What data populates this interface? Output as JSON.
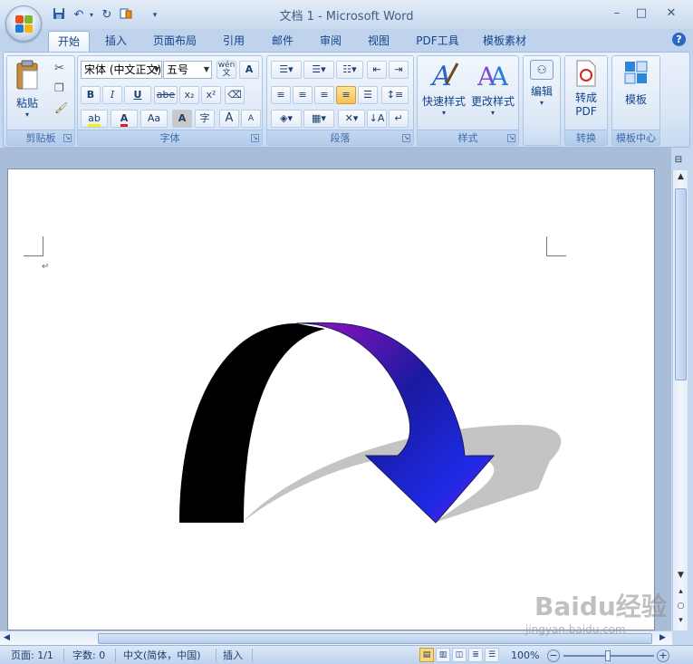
{
  "window": {
    "title": "文档 1 - Microsoft Word",
    "minimize": "–",
    "maximize": "□",
    "close": "✕"
  },
  "quick_access": [
    "save-icon",
    "undo-icon",
    "redo-icon",
    "print-layout-icon",
    "customize-arrow-icon"
  ],
  "tabs": [
    {
      "label": "开始",
      "active": true
    },
    {
      "label": "插入"
    },
    {
      "label": "页面布局"
    },
    {
      "label": "引用"
    },
    {
      "label": "邮件"
    },
    {
      "label": "审阅"
    },
    {
      "label": "视图"
    },
    {
      "label": "PDF工具"
    },
    {
      "label": "模板素材"
    }
  ],
  "ribbon": {
    "clipboard": {
      "label": "剪贴板",
      "paste": "粘贴"
    },
    "font": {
      "label": "字体",
      "font_name": "宋体 (中文正文)",
      "font_size": "五号",
      "phonetic": "wén 文",
      "border_char": "A",
      "bold": "B",
      "italic": "I",
      "underline": "U",
      "strike": "abe",
      "subscript": "x₂",
      "superscript": "x²",
      "change_case": "Aa",
      "grow": "A",
      "shrink": "A",
      "enclose": "字"
    },
    "paragraph": {
      "label": "段落"
    },
    "styles": {
      "label": "样式",
      "quick_styles": "快速样式",
      "change_styles": "更改样式"
    },
    "editing": {
      "label": "编辑"
    },
    "convert": {
      "label": "转换",
      "to_pdf": "转成\nPDF",
      "to_pdf_line1": "转成",
      "to_pdf_line2": "PDF"
    },
    "templates": {
      "label": "模板中心",
      "template": "模板"
    }
  },
  "document": {
    "shape": "curved-down-arrow",
    "colors": {
      "dark_face": "#000000",
      "gradient_start": "#8a10c8",
      "gradient_mid": "#1a1aa0",
      "gradient_end": "#1e1ee0",
      "shadow": "#c4c4c4"
    }
  },
  "status": {
    "page": "页面: 1/1",
    "words": "字数: 0",
    "language": "中文(简体，中国)",
    "insert": "插入",
    "zoom": "100%"
  },
  "watermark": {
    "logo": "Baidu经验",
    "url": "jingyan.baidu.com"
  }
}
